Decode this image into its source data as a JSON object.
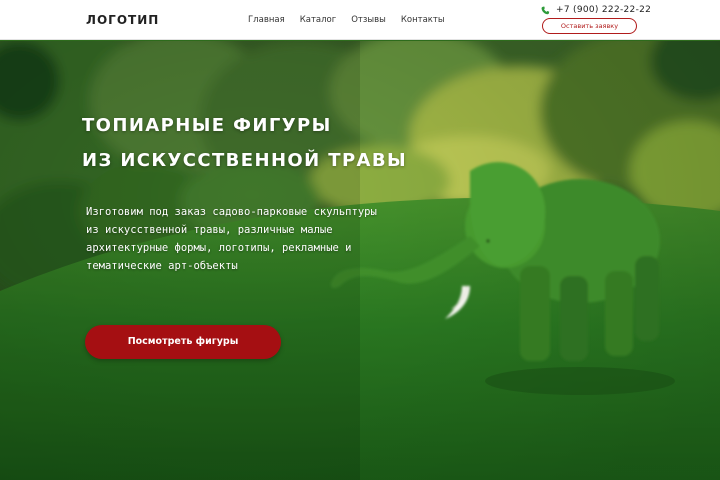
{
  "header": {
    "logo": "ЛОГОТИП",
    "nav": [
      {
        "label": "Главная"
      },
      {
        "label": "Каталог"
      },
      {
        "label": "Отзывы"
      },
      {
        "label": "Контакты"
      }
    ],
    "phone": "+7 (900) 222-22-22",
    "phone_icon": "phone-icon",
    "order_button": "Оставить заявку"
  },
  "hero": {
    "title_line1": "ТОПИАРНЫЕ ФИГУРЫ",
    "title_line2": "ИЗ ИСКУССТВЕННОЙ ТРАВЫ",
    "desc_line1": "Изготовим под заказ садово-парковые скульптуры",
    "desc_line2": "из искусственной травы, различные малые",
    "desc_line3": "архитектурные формы, логотипы, рекламные и",
    "desc_line4": "тематические арт-объекты",
    "cta": "Посмотреть фигуры"
  },
  "colors": {
    "accent": "#a50f12",
    "phone_icon": "#2e9b3a",
    "order_border": "#b11c1c"
  }
}
